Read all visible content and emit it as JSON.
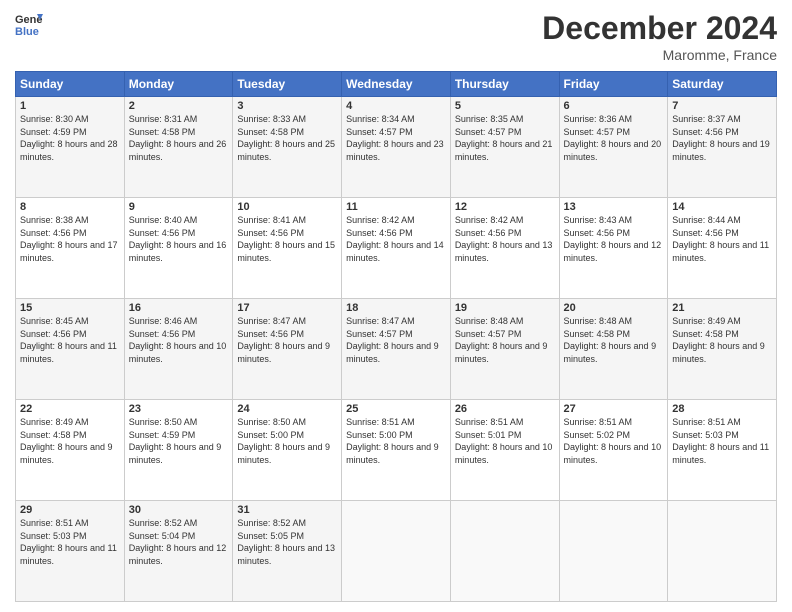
{
  "header": {
    "logo_line1": "General",
    "logo_line2": "Blue",
    "month": "December 2024",
    "location": "Maromme, France"
  },
  "weekdays": [
    "Sunday",
    "Monday",
    "Tuesday",
    "Wednesday",
    "Thursday",
    "Friday",
    "Saturday"
  ],
  "weeks": [
    [
      {
        "day": "1",
        "sunrise": "Sunrise: 8:30 AM",
        "sunset": "Sunset: 4:59 PM",
        "daylight": "Daylight: 8 hours and 28 minutes."
      },
      {
        "day": "2",
        "sunrise": "Sunrise: 8:31 AM",
        "sunset": "Sunset: 4:58 PM",
        "daylight": "Daylight: 8 hours and 26 minutes."
      },
      {
        "day": "3",
        "sunrise": "Sunrise: 8:33 AM",
        "sunset": "Sunset: 4:58 PM",
        "daylight": "Daylight: 8 hours and 25 minutes."
      },
      {
        "day": "4",
        "sunrise": "Sunrise: 8:34 AM",
        "sunset": "Sunset: 4:57 PM",
        "daylight": "Daylight: 8 hours and 23 minutes."
      },
      {
        "day": "5",
        "sunrise": "Sunrise: 8:35 AM",
        "sunset": "Sunset: 4:57 PM",
        "daylight": "Daylight: 8 hours and 21 minutes."
      },
      {
        "day": "6",
        "sunrise": "Sunrise: 8:36 AM",
        "sunset": "Sunset: 4:57 PM",
        "daylight": "Daylight: 8 hours and 20 minutes."
      },
      {
        "day": "7",
        "sunrise": "Sunrise: 8:37 AM",
        "sunset": "Sunset: 4:56 PM",
        "daylight": "Daylight: 8 hours and 19 minutes."
      }
    ],
    [
      {
        "day": "8",
        "sunrise": "Sunrise: 8:38 AM",
        "sunset": "Sunset: 4:56 PM",
        "daylight": "Daylight: 8 hours and 17 minutes."
      },
      {
        "day": "9",
        "sunrise": "Sunrise: 8:40 AM",
        "sunset": "Sunset: 4:56 PM",
        "daylight": "Daylight: 8 hours and 16 minutes."
      },
      {
        "day": "10",
        "sunrise": "Sunrise: 8:41 AM",
        "sunset": "Sunset: 4:56 PM",
        "daylight": "Daylight: 8 hours and 15 minutes."
      },
      {
        "day": "11",
        "sunrise": "Sunrise: 8:42 AM",
        "sunset": "Sunset: 4:56 PM",
        "daylight": "Daylight: 8 hours and 14 minutes."
      },
      {
        "day": "12",
        "sunrise": "Sunrise: 8:42 AM",
        "sunset": "Sunset: 4:56 PM",
        "daylight": "Daylight: 8 hours and 13 minutes."
      },
      {
        "day": "13",
        "sunrise": "Sunrise: 8:43 AM",
        "sunset": "Sunset: 4:56 PM",
        "daylight": "Daylight: 8 hours and 12 minutes."
      },
      {
        "day": "14",
        "sunrise": "Sunrise: 8:44 AM",
        "sunset": "Sunset: 4:56 PM",
        "daylight": "Daylight: 8 hours and 11 minutes."
      }
    ],
    [
      {
        "day": "15",
        "sunrise": "Sunrise: 8:45 AM",
        "sunset": "Sunset: 4:56 PM",
        "daylight": "Daylight: 8 hours and 11 minutes."
      },
      {
        "day": "16",
        "sunrise": "Sunrise: 8:46 AM",
        "sunset": "Sunset: 4:56 PM",
        "daylight": "Daylight: 8 hours and 10 minutes."
      },
      {
        "day": "17",
        "sunrise": "Sunrise: 8:47 AM",
        "sunset": "Sunset: 4:56 PM",
        "daylight": "Daylight: 8 hours and 9 minutes."
      },
      {
        "day": "18",
        "sunrise": "Sunrise: 8:47 AM",
        "sunset": "Sunset: 4:57 PM",
        "daylight": "Daylight: 8 hours and 9 minutes."
      },
      {
        "day": "19",
        "sunrise": "Sunrise: 8:48 AM",
        "sunset": "Sunset: 4:57 PM",
        "daylight": "Daylight: 8 hours and 9 minutes."
      },
      {
        "day": "20",
        "sunrise": "Sunrise: 8:48 AM",
        "sunset": "Sunset: 4:58 PM",
        "daylight": "Daylight: 8 hours and 9 minutes."
      },
      {
        "day": "21",
        "sunrise": "Sunrise: 8:49 AM",
        "sunset": "Sunset: 4:58 PM",
        "daylight": "Daylight: 8 hours and 9 minutes."
      }
    ],
    [
      {
        "day": "22",
        "sunrise": "Sunrise: 8:49 AM",
        "sunset": "Sunset: 4:58 PM",
        "daylight": "Daylight: 8 hours and 9 minutes."
      },
      {
        "day": "23",
        "sunrise": "Sunrise: 8:50 AM",
        "sunset": "Sunset: 4:59 PM",
        "daylight": "Daylight: 8 hours and 9 minutes."
      },
      {
        "day": "24",
        "sunrise": "Sunrise: 8:50 AM",
        "sunset": "Sunset: 5:00 PM",
        "daylight": "Daylight: 8 hours and 9 minutes."
      },
      {
        "day": "25",
        "sunrise": "Sunrise: 8:51 AM",
        "sunset": "Sunset: 5:00 PM",
        "daylight": "Daylight: 8 hours and 9 minutes."
      },
      {
        "day": "26",
        "sunrise": "Sunrise: 8:51 AM",
        "sunset": "Sunset: 5:01 PM",
        "daylight": "Daylight: 8 hours and 10 minutes."
      },
      {
        "day": "27",
        "sunrise": "Sunrise: 8:51 AM",
        "sunset": "Sunset: 5:02 PM",
        "daylight": "Daylight: 8 hours and 10 minutes."
      },
      {
        "day": "28",
        "sunrise": "Sunrise: 8:51 AM",
        "sunset": "Sunset: 5:03 PM",
        "daylight": "Daylight: 8 hours and 11 minutes."
      }
    ],
    [
      {
        "day": "29",
        "sunrise": "Sunrise: 8:51 AM",
        "sunset": "Sunset: 5:03 PM",
        "daylight": "Daylight: 8 hours and 11 minutes."
      },
      {
        "day": "30",
        "sunrise": "Sunrise: 8:52 AM",
        "sunset": "Sunset: 5:04 PM",
        "daylight": "Daylight: 8 hours and 12 minutes."
      },
      {
        "day": "31",
        "sunrise": "Sunrise: 8:52 AM",
        "sunset": "Sunset: 5:05 PM",
        "daylight": "Daylight: 8 hours and 13 minutes."
      },
      null,
      null,
      null,
      null
    ]
  ]
}
